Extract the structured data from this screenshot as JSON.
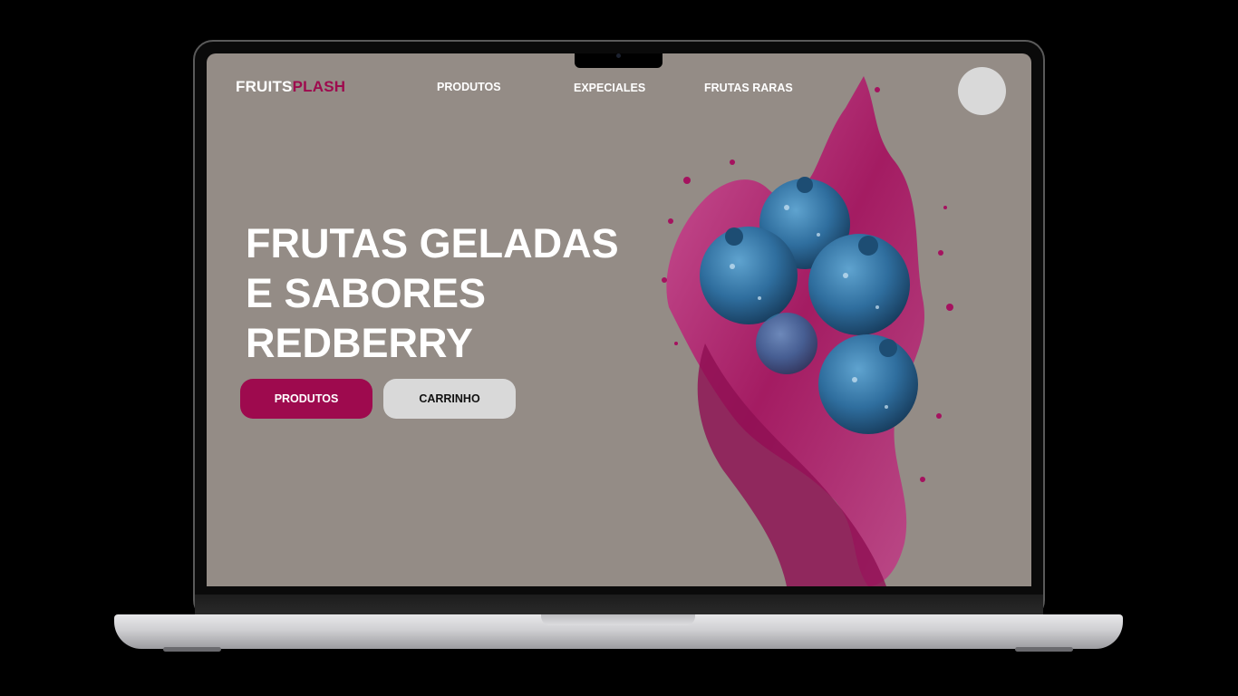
{
  "brand": {
    "part1": "FRUITS",
    "part2": "PLASH",
    "accent": "#9e0a4e"
  },
  "nav": {
    "items": [
      {
        "label": "PRODUTOS"
      },
      {
        "label": "EXPECIALES"
      },
      {
        "label": "FRUTAS RARAS"
      }
    ]
  },
  "hero": {
    "title_lines": [
      "FRUTAS GELADAS",
      "E SABORES",
      "REDBERRY"
    ],
    "primary_button": "PRODUTOS",
    "secondary_button": "CARRINHO"
  },
  "colors": {
    "background": "#948c86",
    "primary": "#9e0a4e",
    "secondary": "#d9d9d9",
    "splash": "#b0186e",
    "berry": "#2f6e9e"
  },
  "image": {
    "subject": "blueberries-in-magenta-juice-splash"
  }
}
